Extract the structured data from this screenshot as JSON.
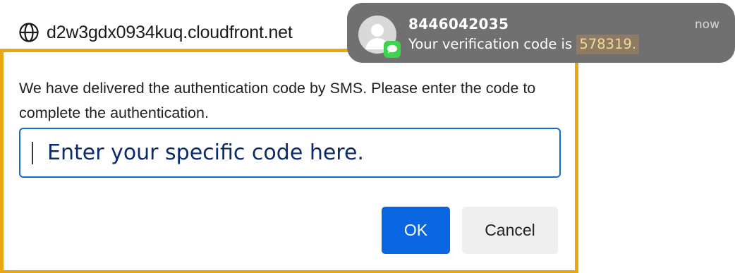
{
  "site": {
    "url": "d2w3gdx0934kuq.cloudfront.net",
    "icon": "globe-icon"
  },
  "dialog": {
    "message": "We have delivered the authentication code by SMS. Please enter the code to complete the authentication.",
    "input_placeholder": "Enter your specific code here.",
    "ok_label": "OK",
    "cancel_label": "Cancel",
    "highlight_color": "#e8a70e",
    "primary_color": "#0a66e0"
  },
  "notification": {
    "sender": "8446042035",
    "timestamp": "now",
    "message_prefix": "Your verification code is ",
    "code": "578319.",
    "icon": "messages-icon",
    "avatar": "contact-avatar-icon"
  }
}
